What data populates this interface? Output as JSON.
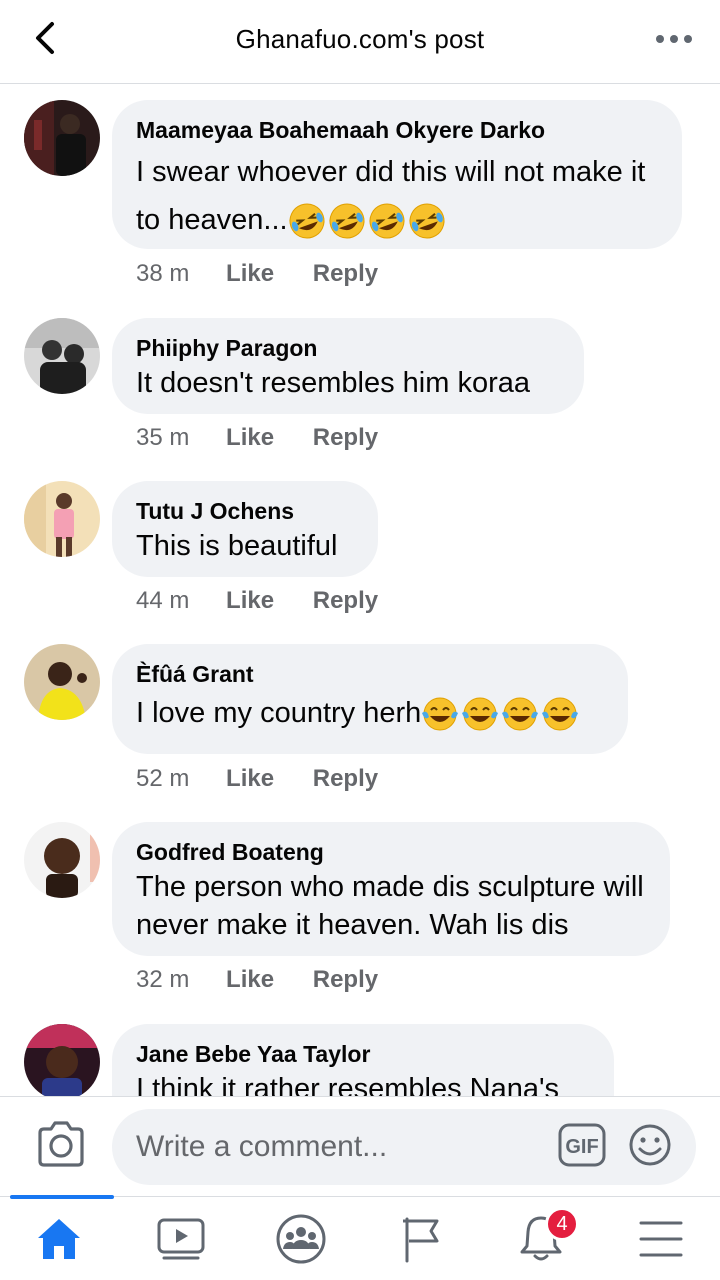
{
  "header": {
    "title": "Ghanafuo.com's post"
  },
  "comments": [
    {
      "author": "Maameyaa Boahemaah Okyere  Darko",
      "text": "I swear whoever did this will not make it to heaven...",
      "emoji": "rolling-on-floor-laughing x4",
      "time": "38 m",
      "like": "Like",
      "reply": "Reply"
    },
    {
      "author": "Phiiphy Paragon",
      "text": "It doesn't resembles him koraa",
      "time": "35 m",
      "like": "Like",
      "reply": "Reply"
    },
    {
      "author": "Tutu J Ochens",
      "text": "This is beautiful",
      "time": "44 m",
      "like": "Like",
      "reply": "Reply"
    },
    {
      "author": "Èfûá Grant",
      "text": "I love my country herh",
      "emoji": "tears-of-joy x4",
      "time": "52 m",
      "like": "Like",
      "reply": "Reply"
    },
    {
      "author": "Godfred Boateng",
      "text": "The person who made dis sculpture will never make it heaven. Wah lis dis",
      "time": "32 m",
      "like": "Like",
      "reply": "Reply"
    },
    {
      "author": "Jane Bebe Yaa Taylor",
      "text": "I think it rather resembles Nana's"
    }
  ],
  "composer": {
    "placeholder": "Write a comment...",
    "gif_label": "GIF"
  },
  "nav": {
    "items": [
      "home-icon",
      "watch-icon",
      "groups-icon",
      "pages-icon",
      "notifications-icon",
      "menu-icon"
    ],
    "active": "home-icon",
    "notification_count": "4"
  },
  "colors": {
    "accent": "#1877f2",
    "bubble": "#f0f2f5",
    "meta": "#65676b",
    "badge": "#e41e3f"
  }
}
